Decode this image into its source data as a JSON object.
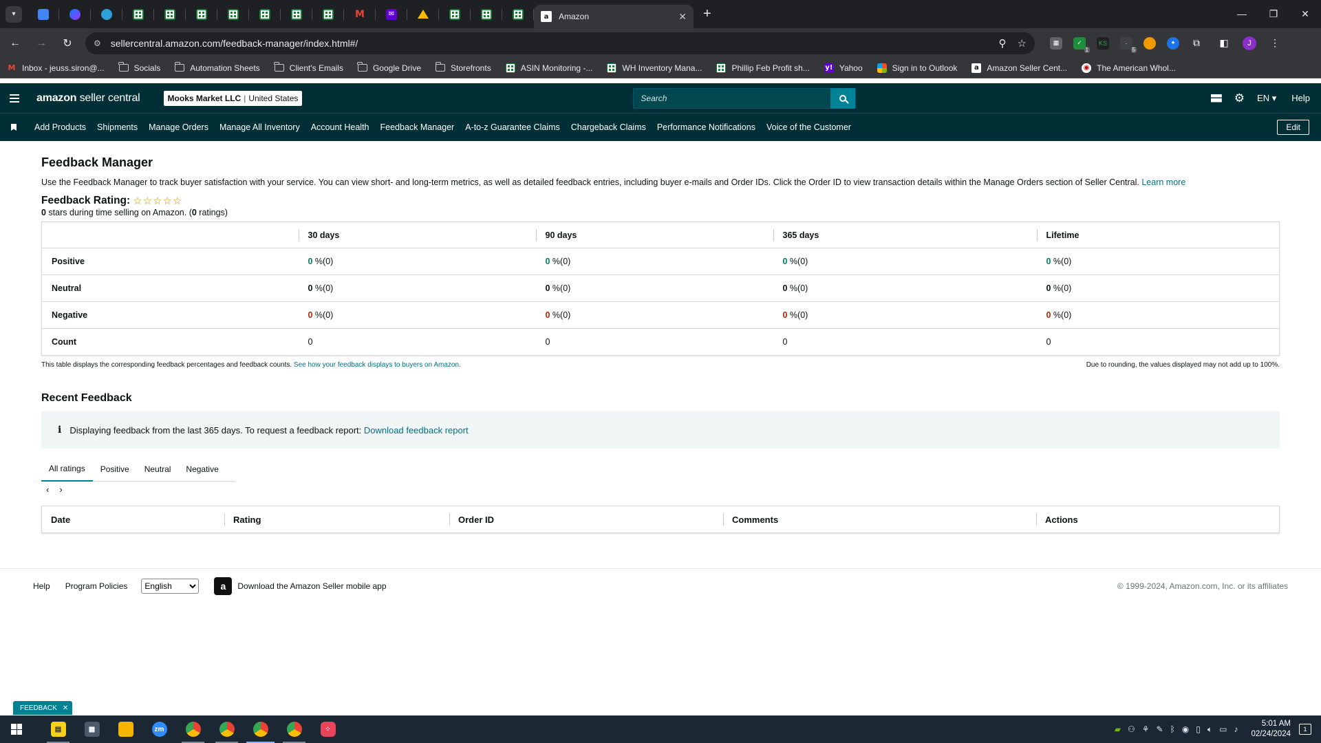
{
  "browser": {
    "active_tab_title": "Amazon",
    "url": "sellercentral.amazon.com/feedback-manager/index.html#/",
    "bookmarks": [
      {
        "label": "Inbox - jeuss.siron@...",
        "icon": "gmail-icon"
      },
      {
        "label": "Socials",
        "icon": "folder-icon"
      },
      {
        "label": "Automation Sheets",
        "icon": "folder-icon"
      },
      {
        "label": "Client's Emails",
        "icon": "folder-icon"
      },
      {
        "label": "Google Drive",
        "icon": "folder-icon"
      },
      {
        "label": "Storefronts",
        "icon": "folder-icon"
      },
      {
        "label": "ASIN Monitoring -...",
        "icon": "sheets-icon"
      },
      {
        "label": "WH Inventory Mana...",
        "icon": "sheets-icon"
      },
      {
        "label": "Phillip Feb Profit sh...",
        "icon": "sheets-icon"
      },
      {
        "label": "Yahoo",
        "icon": "yahoo-icon"
      },
      {
        "label": "Sign in to Outlook",
        "icon": "microsoft-icon"
      },
      {
        "label": "Amazon Seller Cent...",
        "icon": "amazon-icon"
      },
      {
        "label": "The American Whol...",
        "icon": "site-icon"
      }
    ],
    "profile_initial": "J",
    "ext_badge_1": "1",
    "ext_badge_5": "5"
  },
  "header": {
    "logo_bold": "amazon",
    "logo_rest": " seller central",
    "store_name": "Mooks Market LLC",
    "store_sep": "|",
    "store_region": "United States",
    "search_placeholder": "Search",
    "language": "EN",
    "help": "Help"
  },
  "nav": {
    "items": [
      "Add Products",
      "Shipments",
      "Manage Orders",
      "Manage All Inventory",
      "Account Health",
      "Feedback Manager",
      "A-to-z Guarantee Claims",
      "Chargeback Claims",
      "Performance Notifications",
      "Voice of the Customer"
    ],
    "edit": "Edit"
  },
  "page": {
    "title": "Feedback Manager",
    "description": "Use the Feedback Manager to track buyer satisfaction with your service. You can view short- and long-term metrics, as well as detailed feedback entries, including buyer e-mails and Order IDs. Click the Order ID to view transaction details within the Manage Orders section of Seller Central.",
    "learn_more": "Learn more",
    "rating_label": "Feedback Rating:",
    "stars_glyphs": "☆☆☆☆☆",
    "stars_value": 0,
    "rating_sub_bold": "0",
    "rating_sub_text": " stars during time selling on Amazon. (",
    "rating_sub_count": "0",
    "rating_sub_end": " ratings)"
  },
  "feedback_table": {
    "columns": [
      "",
      "30 days",
      "90 days",
      "365 days",
      "Lifetime"
    ],
    "rows": [
      {
        "label": "Positive",
        "cells": [
          {
            "n": "0",
            "rest": " %(0)"
          },
          {
            "n": "0",
            "rest": " %(0)"
          },
          {
            "n": "0",
            "rest": " %(0)"
          },
          {
            "n": "0",
            "rest": " %(0)"
          }
        ]
      },
      {
        "label": "Neutral",
        "cells": [
          {
            "n": "0",
            "rest": " %(0)"
          },
          {
            "n": "0",
            "rest": " %(0)"
          },
          {
            "n": "0",
            "rest": " %(0)"
          },
          {
            "n": "0",
            "rest": " %(0)"
          }
        ]
      },
      {
        "label": "Negative",
        "cells": [
          {
            "n": "0",
            "rest": " %(0)"
          },
          {
            "n": "0",
            "rest": " %(0)"
          },
          {
            "n": "0",
            "rest": " %(0)"
          },
          {
            "n": "0",
            "rest": " %(0)"
          }
        ]
      },
      {
        "label": "Count",
        "cells": [
          {
            "n": "0"
          },
          {
            "n": "0"
          },
          {
            "n": "0"
          },
          {
            "n": "0"
          }
        ]
      }
    ],
    "note_left": "This table displays the corresponding feedback percentages and feedback counts.",
    "note_link": "See how your feedback displays to buyers on Amazon.",
    "note_right": "Due to rounding, the values displayed may not add up to 100%."
  },
  "recent": {
    "title": "Recent Feedback",
    "info_text": "Displaying feedback from the last 365 days. To request a feedback report:",
    "info_link": "Download feedback report",
    "tabs": [
      "All ratings",
      "Positive",
      "Neutral",
      "Negative"
    ],
    "columns": [
      "Date",
      "Rating",
      "Order ID",
      "Comments",
      "Actions"
    ]
  },
  "footer": {
    "help": "Help",
    "policies": "Program Policies",
    "language": "English",
    "app_text": "Download the Amazon Seller mobile app",
    "copyright": "© 1999-2024, Amazon.com, Inc. or its affiliates",
    "feedback_pill": "FEEDBACK"
  },
  "taskbar": {
    "time": "5:01 AM",
    "date": "02/24/2024",
    "notification_count": "1"
  },
  "colors": {
    "header_bg": "#002f36",
    "accent": "#008296",
    "positive": "#067d62",
    "negative": "#b12704"
  }
}
